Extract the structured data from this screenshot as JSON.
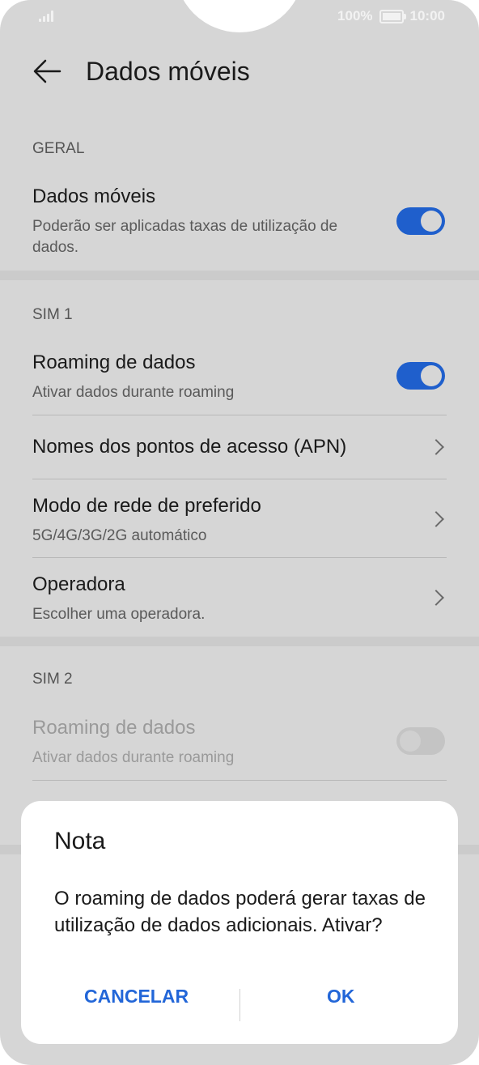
{
  "status_bar": {
    "battery": "100%",
    "time": "10:00"
  },
  "header": {
    "title": "Dados móveis"
  },
  "general": {
    "label": "GERAL",
    "mobile_data": {
      "title": "Dados móveis",
      "subtitle": "Poderão ser aplicadas taxas de utilização de dados.",
      "enabled": true
    }
  },
  "sim1": {
    "label": "SIM 1",
    "roaming": {
      "title": "Roaming de dados",
      "subtitle": "Ativar dados durante roaming",
      "enabled": true
    },
    "apn": {
      "title": "Nomes dos pontos de acesso (APN)"
    },
    "network_mode": {
      "title": "Modo de rede de preferido",
      "subtitle": "5G/4G/3G/2G automático"
    },
    "operator": {
      "title": "Operadora",
      "subtitle": "Escolher uma operadora."
    }
  },
  "sim2": {
    "label": "SIM 2",
    "roaming": {
      "title": "Roaming de dados",
      "subtitle": "Ativar dados durante roaming",
      "enabled": false
    }
  },
  "dialog": {
    "title": "Nota",
    "message": "O roaming de dados poderá gerar taxas de utilização de dados adicionais. Ativar?",
    "cancel_label": "CANCELAR",
    "ok_label": "OK"
  },
  "colors": {
    "accent": "#1f5fcc",
    "dialog_button": "#2266d8",
    "scrim": "#d6d6d6"
  }
}
